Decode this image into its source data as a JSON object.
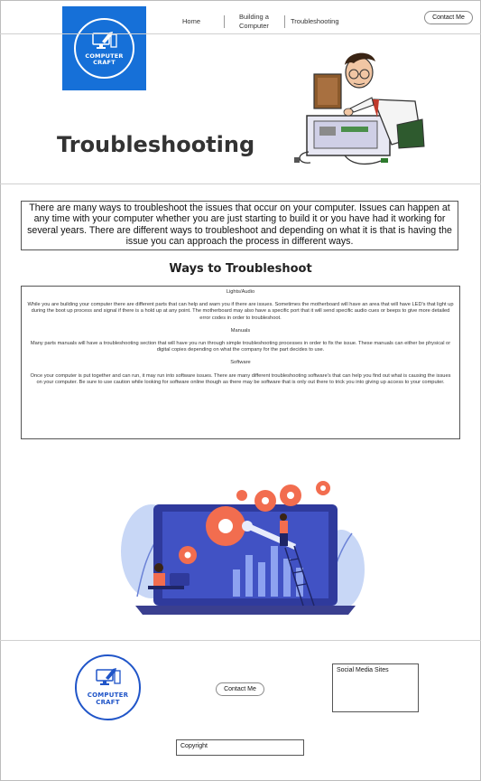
{
  "brand": {
    "logo_line1": "COMPUTER",
    "logo_line2": "CRAFT"
  },
  "nav": {
    "home": "Home",
    "building_line1": "Building a",
    "building_line2": "Computer",
    "troubleshooting": "Troubleshooting",
    "contact": "Contact Me"
  },
  "hero": {
    "title": "Troubleshooting"
  },
  "intro": "There are many ways to troubleshoot the issues that occur on your computer. Issues can happen at any time with your computer whether you are just starting to build it or you have had it working for several years. There are different ways to troubleshoot and depending on what it is that is having the issue you can approach the process in different ways.",
  "ways": {
    "heading": "Ways to Troubleshoot",
    "sections": [
      {
        "title": "Lights/Audio",
        "text": "While you are building your computer there are different parts that can help and warn you if there are issues. Sometimes the motherboard will have an area that will have LED's that light up during the boot up process and signal if there is a hold up at any point. The motherboard may also have a specific port that it will send specific audio cues or beeps to give more detailed error codes in order to troubleshoot."
      },
      {
        "title": "Manuals",
        "text": "Many parts manuals will have a troubleshooting section that will have you run through simple troubleshooting processes in order to fix the issue. These manuals can either be physical or digital copies depending on what the company for the part decides to use."
      },
      {
        "title": "Software",
        "text": "Once your computer is put together and can run, it may run into software issues. There are many different troubleshooting software's that can help you find out what is causing the issues on your computer. Be sure to use caution while looking for software online though as there may be software that is only out there to trick you into giving up access to your computer."
      }
    ]
  },
  "footer": {
    "contact": "Contact Me",
    "social_label": "Social Media Sites",
    "copyright": "Copyright"
  },
  "colors": {
    "brand_blue": "#1670d8",
    "footer_blue": "#2055c8",
    "illustration_orange": "#f26d4f",
    "illustration_navy": "#2f3a9c"
  }
}
